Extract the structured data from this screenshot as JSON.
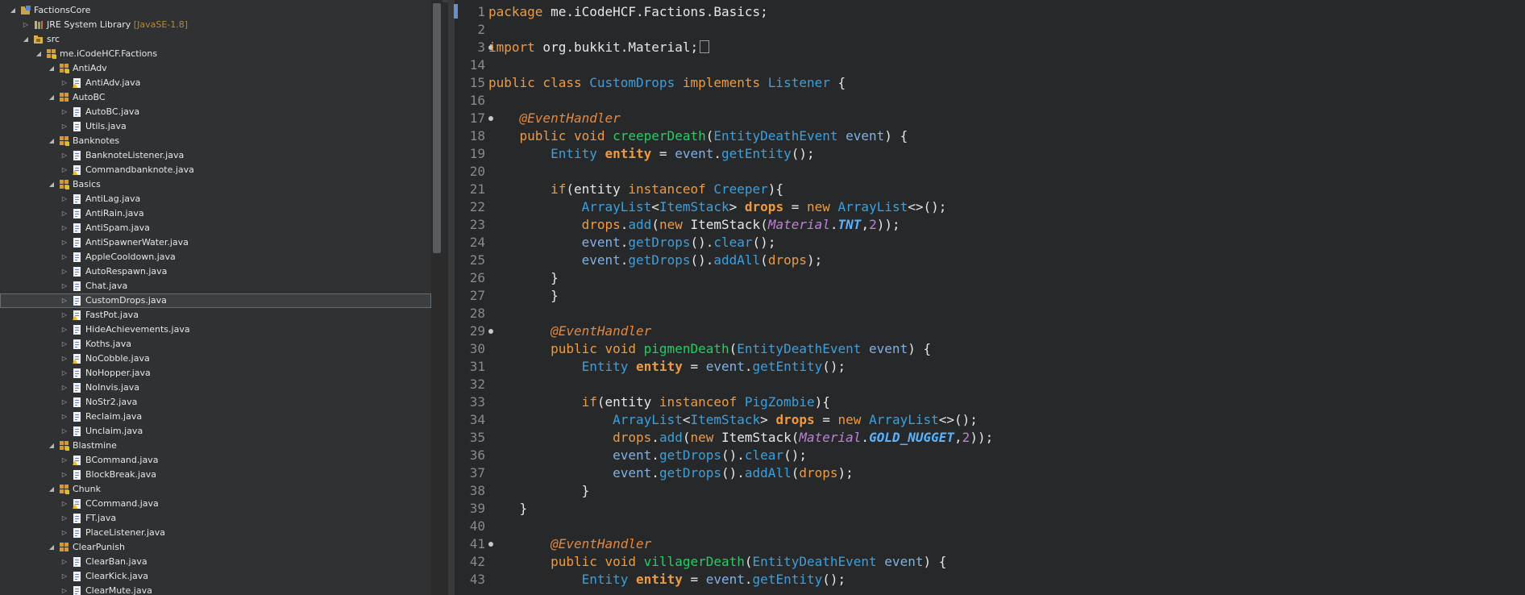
{
  "explorer": {
    "nodes": [
      {
        "label": "FactionsCore",
        "depth": 0,
        "twisty": "open",
        "icon": "project"
      },
      {
        "label": "JRE System Library",
        "decoration": "[JavaSE-1.8]",
        "depth": 1,
        "twisty": "closed",
        "icon": "library"
      },
      {
        "label": "src",
        "depth": 1,
        "twisty": "open",
        "icon": "source-folder"
      },
      {
        "label": "me.iCodeHCF.Factions",
        "depth": 2,
        "twisty": "open",
        "icon": "package"
      },
      {
        "label": "AntiAdv",
        "depth": 3,
        "twisty": "open",
        "icon": "package"
      },
      {
        "label": "AntiAdv.java",
        "depth": 4,
        "twisty": "closed",
        "icon": "java-warn"
      },
      {
        "label": "AutoBC",
        "depth": 3,
        "twisty": "open",
        "icon": "package-plain"
      },
      {
        "label": "AutoBC.java",
        "depth": 4,
        "twisty": "closed",
        "icon": "java"
      },
      {
        "label": "Utils.java",
        "depth": 4,
        "twisty": "closed",
        "icon": "java"
      },
      {
        "label": "Banknotes",
        "depth": 3,
        "twisty": "open",
        "icon": "package"
      },
      {
        "label": "BanknoteListener.java",
        "depth": 4,
        "twisty": "closed",
        "icon": "java"
      },
      {
        "label": "Commandbanknote.java",
        "depth": 4,
        "twisty": "closed",
        "icon": "java-warn"
      },
      {
        "label": "Basics",
        "depth": 3,
        "twisty": "open",
        "icon": "package"
      },
      {
        "label": "AntiLag.java",
        "depth": 4,
        "twisty": "closed",
        "icon": "java"
      },
      {
        "label": "AntiRain.java",
        "depth": 4,
        "twisty": "closed",
        "icon": "java"
      },
      {
        "label": "AntiSpam.java",
        "depth": 4,
        "twisty": "closed",
        "icon": "java"
      },
      {
        "label": "AntiSpawnerWater.java",
        "depth": 4,
        "twisty": "closed",
        "icon": "java"
      },
      {
        "label": "AppleCooldown.java",
        "depth": 4,
        "twisty": "closed",
        "icon": "java"
      },
      {
        "label": "AutoRespawn.java",
        "depth": 4,
        "twisty": "closed",
        "icon": "java"
      },
      {
        "label": "Chat.java",
        "depth": 4,
        "twisty": "closed",
        "icon": "java"
      },
      {
        "label": "CustomDrops.java",
        "depth": 4,
        "twisty": "closed",
        "icon": "java",
        "selected": true
      },
      {
        "label": "FastPot.java",
        "depth": 4,
        "twisty": "closed",
        "icon": "java-warn"
      },
      {
        "label": "HideAchievements.java",
        "depth": 4,
        "twisty": "closed",
        "icon": "java"
      },
      {
        "label": "Koths.java",
        "depth": 4,
        "twisty": "closed",
        "icon": "java"
      },
      {
        "label": "NoCobble.java",
        "depth": 4,
        "twisty": "closed",
        "icon": "java-warn"
      },
      {
        "label": "NoHopper.java",
        "depth": 4,
        "twisty": "closed",
        "icon": "java"
      },
      {
        "label": "NoInvis.java",
        "depth": 4,
        "twisty": "closed",
        "icon": "java"
      },
      {
        "label": "NoStr2.java",
        "depth": 4,
        "twisty": "closed",
        "icon": "java"
      },
      {
        "label": "Reclaim.java",
        "depth": 4,
        "twisty": "closed",
        "icon": "java"
      },
      {
        "label": "Unclaim.java",
        "depth": 4,
        "twisty": "closed",
        "icon": "java"
      },
      {
        "label": "Blastmine",
        "depth": 3,
        "twisty": "open",
        "icon": "package"
      },
      {
        "label": "BCommand.java",
        "depth": 4,
        "twisty": "closed",
        "icon": "java-warn"
      },
      {
        "label": "BlockBreak.java",
        "depth": 4,
        "twisty": "closed",
        "icon": "java"
      },
      {
        "label": "Chunk",
        "depth": 3,
        "twisty": "open",
        "icon": "package"
      },
      {
        "label": "CCommand.java",
        "depth": 4,
        "twisty": "closed",
        "icon": "java-warn"
      },
      {
        "label": "FT.java",
        "depth": 4,
        "twisty": "closed",
        "icon": "java"
      },
      {
        "label": "PlaceListener.java",
        "depth": 4,
        "twisty": "closed",
        "icon": "java"
      },
      {
        "label": "ClearPunish",
        "depth": 3,
        "twisty": "open",
        "icon": "package-plain"
      },
      {
        "label": "ClearBan.java",
        "depth": 4,
        "twisty": "closed",
        "icon": "java"
      },
      {
        "label": "ClearKick.java",
        "depth": 4,
        "twisty": "closed",
        "icon": "java"
      },
      {
        "label": "ClearMute.java",
        "depth": 4,
        "twisty": "closed",
        "icon": "java"
      }
    ]
  },
  "editor": {
    "file": "CustomDrops.java",
    "lines": [
      {
        "n": "1",
        "tokens": [
          [
            "kw",
            "package"
          ],
          [
            "pl",
            " me.iCodeHCF.Factions.Basics;"
          ]
        ]
      },
      {
        "n": "2",
        "tokens": []
      },
      {
        "n": "3",
        "fold": true,
        "collapsed": true,
        "tokens": [
          [
            "kw",
            "import"
          ],
          [
            "pl",
            " org.bukkit.Material;"
          ]
        ]
      },
      {
        "n": "14",
        "tokens": []
      },
      {
        "n": "15",
        "tokens": [
          [
            "kw",
            "public class "
          ],
          [
            "ty",
            "CustomDrops"
          ],
          [
            "kw",
            " implements "
          ],
          [
            "ty",
            "Listener"
          ],
          [
            "pl",
            " {"
          ]
        ]
      },
      {
        "n": "16",
        "tokens": []
      },
      {
        "n": "17",
        "fold": true,
        "tokens": [
          [
            "pl",
            "    "
          ],
          [
            "an",
            "@EventHandler"
          ]
        ]
      },
      {
        "n": "18",
        "tokens": [
          [
            "pl",
            "    "
          ],
          [
            "kw",
            "public void "
          ],
          [
            "md",
            "creeperDeath"
          ],
          [
            "pl",
            "("
          ],
          [
            "ty",
            "EntityDeathEvent"
          ],
          [
            "pl",
            " "
          ],
          [
            "pm",
            "event"
          ],
          [
            "pl",
            ") {"
          ]
        ]
      },
      {
        "n": "19",
        "tokens": [
          [
            "pl",
            "        "
          ],
          [
            "ty",
            "Entity"
          ],
          [
            "pl",
            " "
          ],
          [
            "lv",
            "entity"
          ],
          [
            "pl",
            " = "
          ],
          [
            "pm",
            "event"
          ],
          [
            "pl",
            "."
          ],
          [
            "ty",
            "getEntity"
          ],
          [
            "pl",
            "();"
          ]
        ]
      },
      {
        "n": "20",
        "tokens": []
      },
      {
        "n": "21",
        "tokens": [
          [
            "pl",
            "        "
          ],
          [
            "kw",
            "if"
          ],
          [
            "pl",
            "(entity "
          ],
          [
            "kw",
            "instanceof"
          ],
          [
            "pl",
            " "
          ],
          [
            "ty",
            "Creeper"
          ],
          [
            "pl",
            "){"
          ]
        ]
      },
      {
        "n": "22",
        "tokens": [
          [
            "pl",
            "            "
          ],
          [
            "ty",
            "ArrayList"
          ],
          [
            "pl",
            "<"
          ],
          [
            "ty",
            "ItemStack"
          ],
          [
            "pl",
            "> "
          ],
          [
            "lv",
            "drops"
          ],
          [
            "pl",
            " = "
          ],
          [
            "kw",
            "new"
          ],
          [
            "pl",
            " "
          ],
          [
            "ty",
            "ArrayList"
          ],
          [
            "pl",
            "<>();"
          ]
        ]
      },
      {
        "n": "23",
        "tokens": [
          [
            "pl",
            "            "
          ],
          [
            "kw",
            "drops"
          ],
          [
            "pl",
            "."
          ],
          [
            "ty",
            "add"
          ],
          [
            "pl",
            "("
          ],
          [
            "kw",
            "new"
          ],
          [
            "pl",
            " ItemStack("
          ],
          [
            "cl",
            "Material"
          ],
          [
            "pl",
            "."
          ],
          [
            "fd",
            "TNT"
          ],
          [
            "pl",
            ","
          ],
          [
            "nm",
            "2"
          ],
          [
            "pl",
            "));"
          ]
        ]
      },
      {
        "n": "24",
        "tokens": [
          [
            "pl",
            "            "
          ],
          [
            "pm",
            "event"
          ],
          [
            "pl",
            "."
          ],
          [
            "ty",
            "getDrops"
          ],
          [
            "pl",
            "()."
          ],
          [
            "ty",
            "clear"
          ],
          [
            "pl",
            "();"
          ]
        ]
      },
      {
        "n": "25",
        "tokens": [
          [
            "pl",
            "            "
          ],
          [
            "pm",
            "event"
          ],
          [
            "pl",
            "."
          ],
          [
            "ty",
            "getDrops"
          ],
          [
            "pl",
            "()."
          ],
          [
            "ty",
            "addAll"
          ],
          [
            "pl",
            "("
          ],
          [
            "kw",
            "drops"
          ],
          [
            "pl",
            ");"
          ]
        ]
      },
      {
        "n": "26",
        "tokens": [
          [
            "pl",
            "        }"
          ]
        ]
      },
      {
        "n": "27",
        "tokens": [
          [
            "pl",
            "        }"
          ]
        ]
      },
      {
        "n": "28",
        "tokens": []
      },
      {
        "n": "29",
        "fold": true,
        "tokens": [
          [
            "pl",
            "        "
          ],
          [
            "an",
            "@EventHandler"
          ]
        ]
      },
      {
        "n": "30",
        "tokens": [
          [
            "pl",
            "        "
          ],
          [
            "kw",
            "public void "
          ],
          [
            "md",
            "pigmenDeath"
          ],
          [
            "pl",
            "("
          ],
          [
            "ty",
            "EntityDeathEvent"
          ],
          [
            "pl",
            " "
          ],
          [
            "pm",
            "event"
          ],
          [
            "pl",
            ") {"
          ]
        ]
      },
      {
        "n": "31",
        "tokens": [
          [
            "pl",
            "            "
          ],
          [
            "ty",
            "Entity"
          ],
          [
            "pl",
            " "
          ],
          [
            "lv",
            "entity"
          ],
          [
            "pl",
            " = "
          ],
          [
            "pm",
            "event"
          ],
          [
            "pl",
            "."
          ],
          [
            "ty",
            "getEntity"
          ],
          [
            "pl",
            "();"
          ]
        ]
      },
      {
        "n": "32",
        "tokens": []
      },
      {
        "n": "33",
        "tokens": [
          [
            "pl",
            "            "
          ],
          [
            "kw",
            "if"
          ],
          [
            "pl",
            "(entity "
          ],
          [
            "kw",
            "instanceof"
          ],
          [
            "pl",
            " "
          ],
          [
            "ty",
            "PigZombie"
          ],
          [
            "pl",
            "){"
          ]
        ]
      },
      {
        "n": "34",
        "tokens": [
          [
            "pl",
            "                "
          ],
          [
            "ty",
            "ArrayList"
          ],
          [
            "pl",
            "<"
          ],
          [
            "ty",
            "ItemStack"
          ],
          [
            "pl",
            "> "
          ],
          [
            "lv",
            "drops"
          ],
          [
            "pl",
            " = "
          ],
          [
            "kw",
            "new"
          ],
          [
            "pl",
            " "
          ],
          [
            "ty",
            "ArrayList"
          ],
          [
            "pl",
            "<>();"
          ]
        ]
      },
      {
        "n": "35",
        "tokens": [
          [
            "pl",
            "                "
          ],
          [
            "kw",
            "drops"
          ],
          [
            "pl",
            "."
          ],
          [
            "ty",
            "add"
          ],
          [
            "pl",
            "("
          ],
          [
            "kw",
            "new"
          ],
          [
            "pl",
            " ItemStack("
          ],
          [
            "cl",
            "Material"
          ],
          [
            "pl",
            "."
          ],
          [
            "fd",
            "GOLD_NUGGET"
          ],
          [
            "pl",
            ","
          ],
          [
            "nm",
            "2"
          ],
          [
            "pl",
            "));"
          ]
        ]
      },
      {
        "n": "36",
        "tokens": [
          [
            "pl",
            "                "
          ],
          [
            "pm",
            "event"
          ],
          [
            "pl",
            "."
          ],
          [
            "ty",
            "getDrops"
          ],
          [
            "pl",
            "()."
          ],
          [
            "ty",
            "clear"
          ],
          [
            "pl",
            "();"
          ]
        ]
      },
      {
        "n": "37",
        "tokens": [
          [
            "pl",
            "                "
          ],
          [
            "pm",
            "event"
          ],
          [
            "pl",
            "."
          ],
          [
            "ty",
            "getDrops"
          ],
          [
            "pl",
            "()."
          ],
          [
            "ty",
            "addAll"
          ],
          [
            "pl",
            "("
          ],
          [
            "kw",
            "drops"
          ],
          [
            "pl",
            ");"
          ]
        ]
      },
      {
        "n": "38",
        "tokens": [
          [
            "pl",
            "            }"
          ]
        ]
      },
      {
        "n": "39",
        "tokens": [
          [
            "pl",
            "    }"
          ]
        ]
      },
      {
        "n": "40",
        "tokens": []
      },
      {
        "n": "41",
        "fold": true,
        "tokens": [
          [
            "pl",
            "        "
          ],
          [
            "an",
            "@EventHandler"
          ]
        ]
      },
      {
        "n": "42",
        "tokens": [
          [
            "pl",
            "        "
          ],
          [
            "kw",
            "public void "
          ],
          [
            "md",
            "villagerDeath"
          ],
          [
            "pl",
            "("
          ],
          [
            "ty",
            "EntityDeathEvent"
          ],
          [
            "pl",
            " "
          ],
          [
            "pm",
            "event"
          ],
          [
            "pl",
            ") {"
          ]
        ]
      },
      {
        "n": "43",
        "tokens": [
          [
            "pl",
            "            "
          ],
          [
            "ty",
            "Entity"
          ],
          [
            "pl",
            " "
          ],
          [
            "lv",
            "entity"
          ],
          [
            "pl",
            " = "
          ],
          [
            "pm",
            "event"
          ],
          [
            "pl",
            "."
          ],
          [
            "ty",
            "getEntity"
          ],
          [
            "pl",
            "();"
          ]
        ]
      }
    ]
  }
}
